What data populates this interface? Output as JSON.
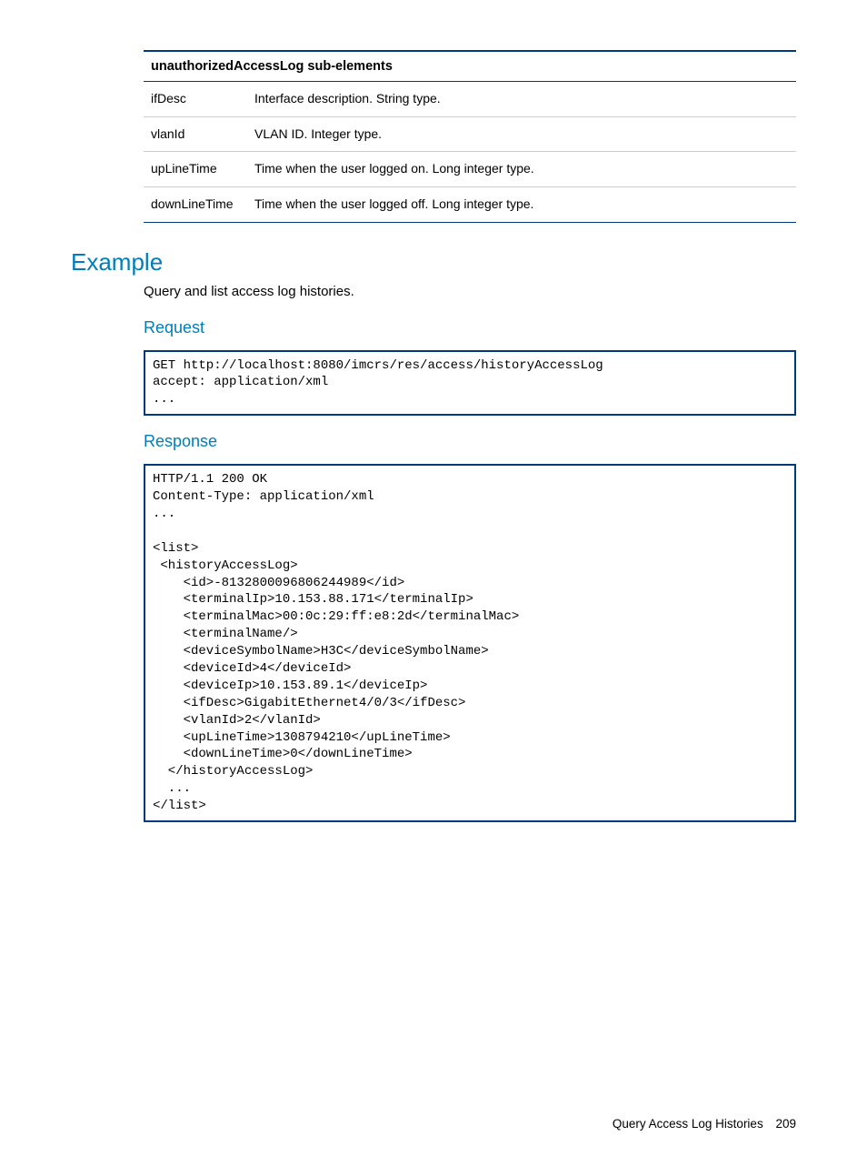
{
  "table": {
    "header": "unauthorizedAccessLog sub-elements",
    "rows": [
      {
        "key": "ifDesc",
        "desc": "Interface description.\nString type."
      },
      {
        "key": "vlanId",
        "desc": "VLAN ID.\nInteger type."
      },
      {
        "key": "upLineTime",
        "desc": "Time when the user logged on.\nLong integer type."
      },
      {
        "key": "downLineTime",
        "desc": "Time when the user logged off.\nLong integer type."
      }
    ]
  },
  "example_heading": "Example",
  "example_lead": "Query and list access log histories.",
  "request_heading": "Request",
  "request_code": "GET http://localhost:8080/imcrs/res/access/historyAccessLog\naccept: application/xml\n...",
  "response_heading": "Response",
  "response_code": "HTTP/1.1 200 OK\nContent-Type: application/xml\n...\n\n<list>\n <historyAccessLog>\n    <id>-8132800096806244989</id>\n    <terminalIp>10.153.88.171</terminalIp>\n    <terminalMac>00:0c:29:ff:e8:2d</terminalMac>\n    <terminalName/>\n    <deviceSymbolName>H3C</deviceSymbolName>\n    <deviceId>4</deviceId>\n    <deviceIp>10.153.89.1</deviceIp>\n    <ifDesc>GigabitEthernet4/0/3</ifDesc>\n    <vlanId>2</vlanId>\n    <upLineTime>1308794210</upLineTime>\n    <downLineTime>0</downLineTime>\n  </historyAccessLog>\n  ...\n</list>",
  "footer_title": "Query Access Log Histories",
  "footer_page": "209"
}
